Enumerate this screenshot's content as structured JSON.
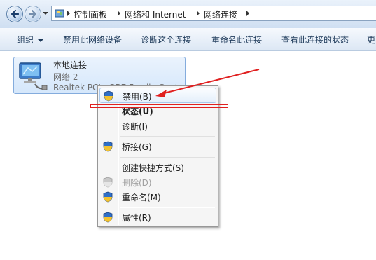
{
  "address_bar": {
    "crumbs": [
      "控制面板",
      "网络和 Internet",
      "网络连接"
    ]
  },
  "toolbar": {
    "organize": "组织",
    "disable_device": "禁用此网络设备",
    "diagnose": "诊断这个连接",
    "rename": "重命名此连接",
    "view_status": "查看此连接的状态",
    "more": "更"
  },
  "connection": {
    "name": "本地连接",
    "network": "网络 2",
    "device": "Realtek PCIe GBE Family Controller"
  },
  "context_menu": {
    "items": [
      {
        "label": "禁用(B)",
        "shield": true
      },
      {
        "label": "状态(U)",
        "bold": true
      },
      {
        "label": "诊断(I)"
      },
      {
        "label": "桥接(G)",
        "shield": true
      },
      {
        "label": "创建快捷方式(S)"
      },
      {
        "label": "删除(D)",
        "disabled": true,
        "shield": true
      },
      {
        "label": "重命名(M)",
        "shield": true
      },
      {
        "label": "属性(R)",
        "shield": true
      }
    ]
  },
  "colors": {
    "annotation": "#e02020",
    "selection": "#d5e7fb"
  }
}
